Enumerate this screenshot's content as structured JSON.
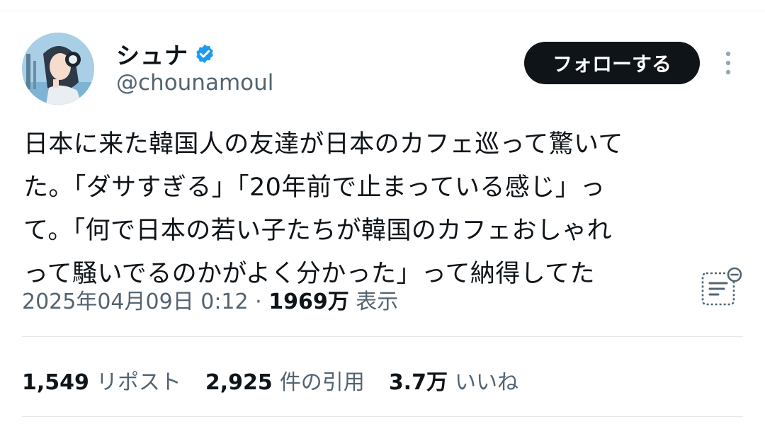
{
  "author": {
    "display_name": "シュナ",
    "handle": "@chounamoul",
    "verified": true,
    "avatar_icon": "anime-character-avatar"
  },
  "follow_button_label": "フォローする",
  "more_icon": "more-vertical-icon",
  "tweet": {
    "text": "日本に来た韓国人の友達が日本のカフェ巡って驚いて\nた。「ダサすぎる」「20年前で止まっている感じ」っ\nて。「何で日本の若い子たちが韓国のカフェおしゃれ\nって騒いでるのかがよく分かった」って納得してた",
    "timestamp": "2025年04月09日 0:12",
    "separator": " · ",
    "views_count": "1969万",
    "views_label": " 表示"
  },
  "grok_icon": "grok-summary-icon",
  "stats": {
    "reposts_count": "1,549",
    "reposts_label": "リポスト",
    "quotes_count": "2,925",
    "quotes_label": "件の引用",
    "likes_count": "3.7万",
    "likes_label": "いいね"
  },
  "colors": {
    "text_primary": "#0f1419",
    "text_secondary": "#536471",
    "verified_blue": "#1d9bf0",
    "follow_bg": "#0f1419",
    "divider": "#eff3f4"
  }
}
